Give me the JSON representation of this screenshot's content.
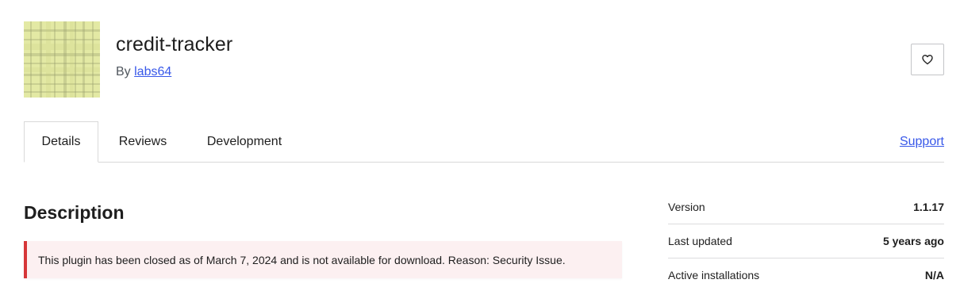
{
  "plugin": {
    "name": "credit-tracker",
    "author_prefix": "By",
    "author": "labs64"
  },
  "favorite": {
    "icon": "heart-icon"
  },
  "tabs": [
    {
      "label": "Details",
      "active": true
    },
    {
      "label": "Reviews",
      "active": false
    },
    {
      "label": "Development",
      "active": false
    }
  ],
  "support_label": "Support",
  "description": {
    "heading": "Description",
    "notice": "This plugin has been closed as of March 7, 2024 and is not available for download. Reason: Security Issue."
  },
  "meta": [
    {
      "label": "Version",
      "value": "1.1.17"
    },
    {
      "label": "Last updated",
      "value": "5 years ago"
    },
    {
      "label": "Active installations",
      "value": "N/A"
    }
  ],
  "colors": {
    "link": "#3858e9",
    "notice_border": "#d63638",
    "notice_bg": "#fcf0f1",
    "icon_base": "#e3e9a4"
  }
}
